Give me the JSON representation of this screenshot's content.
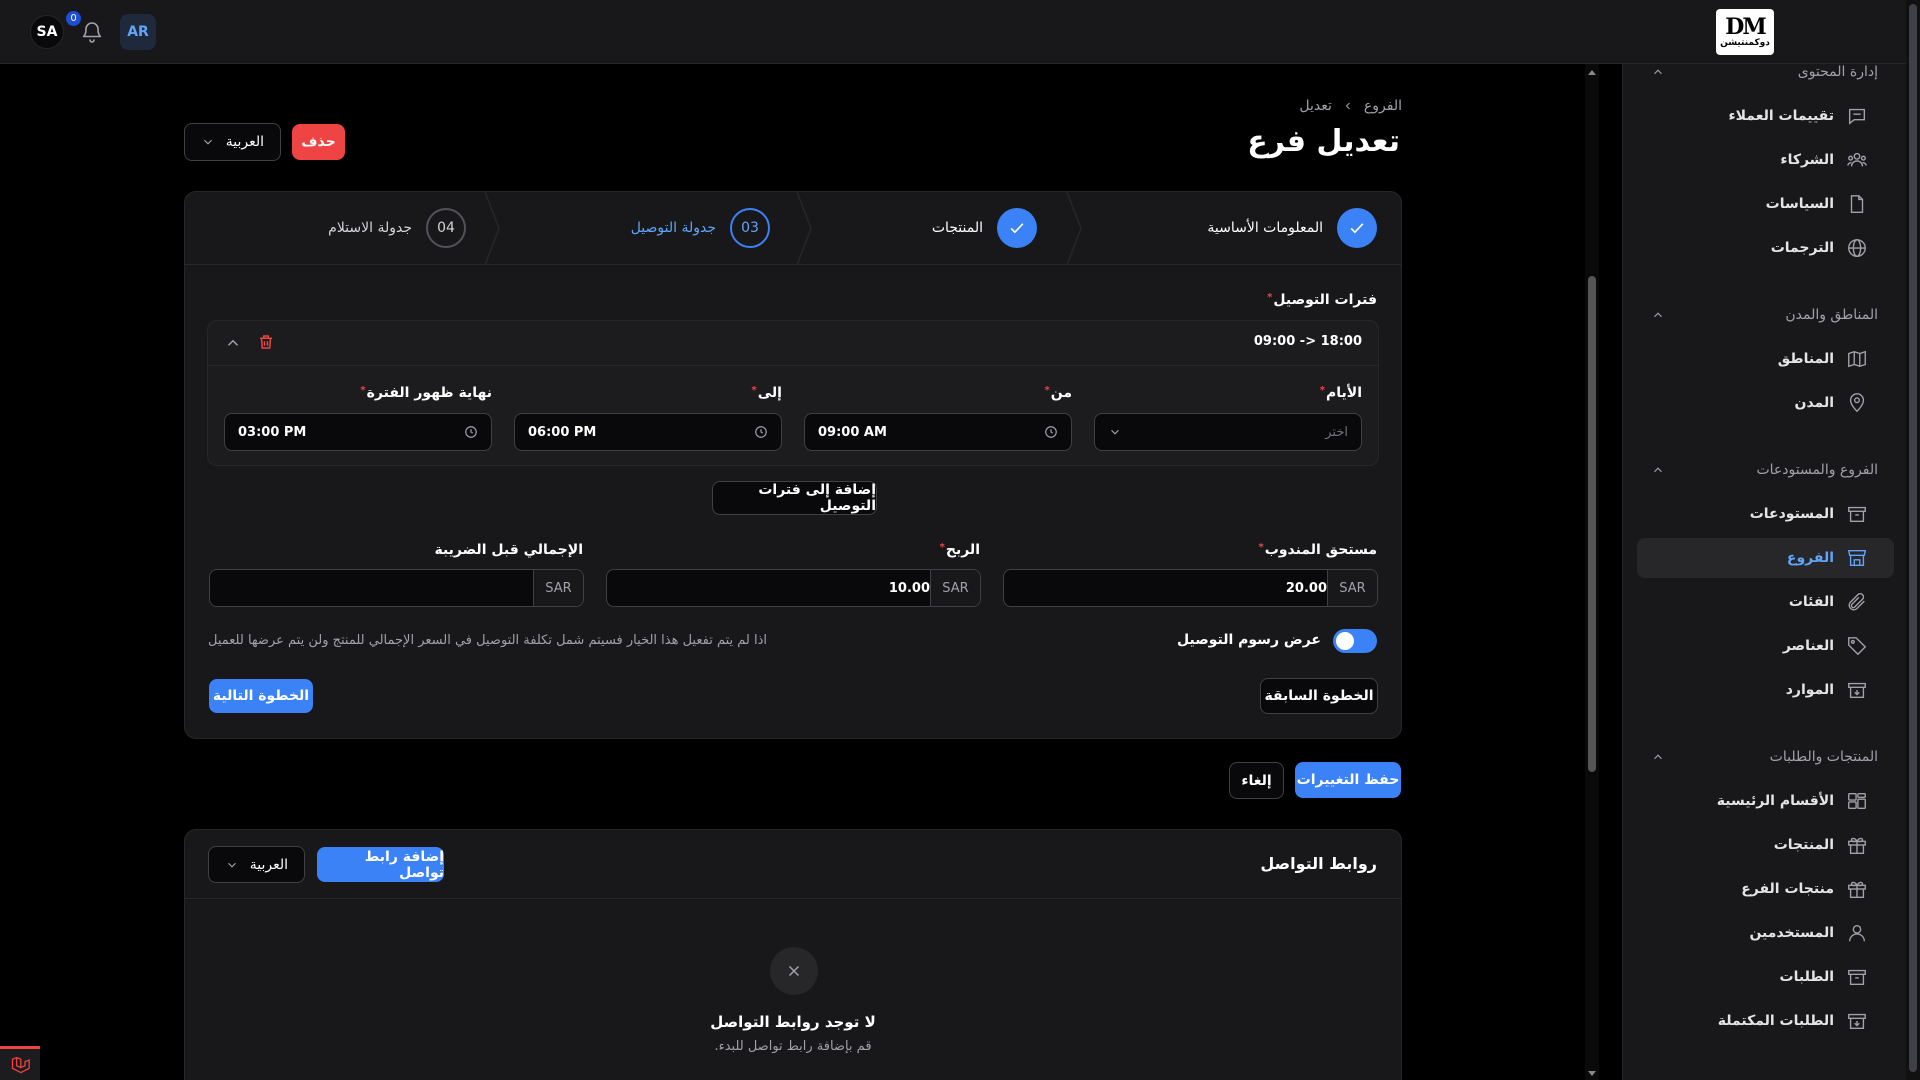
{
  "topbar": {
    "logo_mark": "DM",
    "logo_text": "دوكمنتيشن",
    "avatar_initials": "SA",
    "notifications_count": "0",
    "lang_code": "AR"
  },
  "sidebar": {
    "groups": [
      {
        "title": "إدارة المحتوى",
        "items": [
          {
            "label": "تقييمات العملاء",
            "icon": "chat-icon"
          },
          {
            "label": "الشركاء",
            "icon": "users-icon"
          },
          {
            "label": "السياسات",
            "icon": "document-icon"
          },
          {
            "label": "الترجمات",
            "icon": "globe-icon"
          }
        ]
      },
      {
        "title": "المناطق والمدن",
        "items": [
          {
            "label": "المناطق",
            "icon": "map-icon"
          },
          {
            "label": "المدن",
            "icon": "map-pin-icon"
          }
        ]
      },
      {
        "title": "الفروع والمستودعات",
        "items": [
          {
            "label": "المستودعات",
            "icon": "archive-icon"
          },
          {
            "label": "الفروع",
            "icon": "store-icon",
            "active": true
          },
          {
            "label": "الفئات",
            "icon": "paperclip-icon"
          },
          {
            "label": "العناصر",
            "icon": "tag-icon"
          },
          {
            "label": "الموارد",
            "icon": "archive-down-icon"
          }
        ]
      },
      {
        "title": "المنتجات والطلبات",
        "items": [
          {
            "label": "الأقسام الرئيسية",
            "icon": "grid-icon"
          },
          {
            "label": "المنتجات",
            "icon": "gift-icon"
          },
          {
            "label": "منتجات الفرع",
            "icon": "gift-icon"
          },
          {
            "label": "المستخدمين",
            "icon": "user-icon"
          },
          {
            "label": "الطلبات",
            "icon": "archive-icon"
          },
          {
            "label": "الطلبات المكتملة",
            "icon": "archive-down-icon"
          }
        ]
      }
    ]
  },
  "breadcrumbs": {
    "parent": "الفروع",
    "current": "تعديل"
  },
  "page": {
    "title": "تعديل فرع",
    "delete_label": "حذف",
    "language_select": "العربية"
  },
  "wizard": {
    "steps": [
      {
        "label": "المعلومات الأساسية",
        "state": "done"
      },
      {
        "label": "المنتجات",
        "state": "done"
      },
      {
        "label": "جدولة التوصيل",
        "state": "current",
        "number": "03"
      },
      {
        "label": "جدولة الاستلام",
        "state": "todo",
        "number": "04"
      }
    ],
    "delivery_periods_label": "فترات التوصيل",
    "period": {
      "title": "09:00 -> 18:00",
      "days_label": "الأيام",
      "days_placeholder": "اختر",
      "from_label": "من",
      "from_value": "09:00 AM",
      "to_label": "إلى",
      "to_value": "06:00 PM",
      "visibility_end_label": "نهاية ظهور الفترة",
      "visibility_end_value": "03:00 PM"
    },
    "add_period_label": "إضافة إلى فترات التوصيل",
    "currency": "SAR",
    "rep_due_label": "مستحق المندوب",
    "rep_due_value": "20.00",
    "profit_label": "الربح",
    "profit_value": "10.00",
    "total_before_tax_label": "الإجمالي قبل الضريبة",
    "total_before_tax_value": "",
    "show_fees_label": "عرض رسوم التوصيل",
    "show_fees_on": true,
    "show_fees_hint": "اذا لم يتم تفعيل هذا الخيار فسيتم شمل تكلفة التوصيل في السعر الإجمالي للمنتج ولن يتم عرضها للعميل",
    "prev_label": "الخطوة السابقة",
    "next_label": "الخطوة التالية"
  },
  "form_actions": {
    "save_label": "حفظ التغييرات",
    "cancel_label": "إلغاء"
  },
  "social": {
    "title": "روابط التواصل",
    "add_label": "إضافة رابط تواصل",
    "language_select": "العربية",
    "empty_title": "لا توجد روابط التواصل",
    "empty_hint": "قم بإضافة رابط تواصل للبدء."
  },
  "colors": {
    "accent": "#3b82f6",
    "danger": "#ef4444",
    "surface": "#18181b",
    "background": "#000000"
  }
}
